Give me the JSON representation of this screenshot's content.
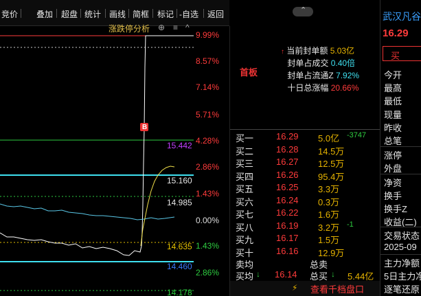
{
  "toolbar": {
    "buttons": [
      "竞价",
      "叠加",
      "超盘",
      "统计",
      "画线",
      "简框",
      "标记",
      "-自选",
      "返回"
    ]
  },
  "chart": {
    "analysis_label": "涨跌停分析",
    "pct_labels": [
      "9.99%",
      "8.57%",
      "7.14%",
      "5.71%",
      "4.28%",
      "2.86%",
      "1.43%",
      "0.00%",
      "1.43%",
      "2.86%"
    ],
    "price_labels": [
      "15.442",
      "15.160",
      "14.985",
      "14.635",
      "14.460",
      "14.178"
    ],
    "marker": "B"
  },
  "seal": {
    "title": "首板",
    "rows": [
      {
        "label": "当前封单额",
        "value": "5.03亿"
      },
      {
        "label": "封单占成交",
        "value": "0.40倍"
      },
      {
        "label": "封单占流通Z",
        "value": "7.92%"
      },
      {
        "label": "十日总涨幅",
        "value": "20.66%"
      }
    ]
  },
  "bids": [
    {
      "name": "买一",
      "price": "16.29",
      "vol": "5.0亿",
      "chg": "-3747"
    },
    {
      "name": "买二",
      "price": "16.28",
      "vol": "14.5万",
      "chg": ""
    },
    {
      "name": "买三",
      "price": "16.27",
      "vol": "12.5万",
      "chg": ""
    },
    {
      "name": "买四",
      "price": "16.26",
      "vol": "95.4万",
      "chg": ""
    },
    {
      "name": "买五",
      "price": "16.25",
      "vol": "3.3万",
      "chg": ""
    },
    {
      "name": "买六",
      "price": "16.24",
      "vol": "0.3万",
      "chg": ""
    },
    {
      "name": "买七",
      "price": "16.22",
      "vol": "1.6万",
      "chg": ""
    },
    {
      "name": "买八",
      "price": "16.19",
      "vol": "3.2万",
      "chg": "-1"
    },
    {
      "name": "买九",
      "price": "16.17",
      "vol": "1.5万",
      "chg": ""
    },
    {
      "name": "买十",
      "price": "16.16",
      "vol": "12.9万",
      "chg": ""
    }
  ],
  "orderbook_footer": {
    "sell_avg": "卖均",
    "buy_avg": "买均",
    "buy_avg_value": "16.14",
    "total_sell": "总卖",
    "total_buy": "总买",
    "total_buy_value": "5.44亿",
    "tick_button": "查看千档盘口"
  },
  "quote": {
    "name": "武汉凡谷",
    "price": "16.29",
    "buy_button": "买",
    "fields": [
      "今开",
      "最高",
      "最低",
      "现量",
      "昨收",
      "总笔",
      "涨停",
      "外盘",
      "净资",
      "换手",
      "换手Z",
      "收益(二)",
      "交易状态",
      "2025-09",
      "主力净额",
      "5日主力净",
      "逐笔还原"
    ]
  }
}
